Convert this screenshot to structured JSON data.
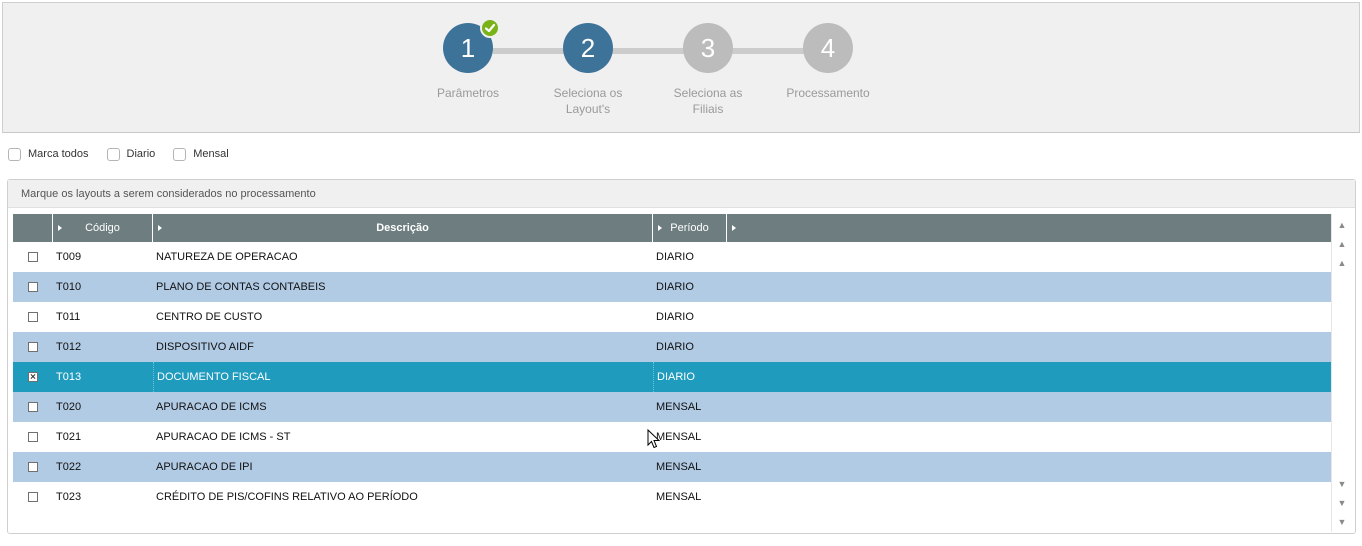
{
  "wizard": {
    "steps": [
      {
        "number": "1",
        "label": "Parâmetros",
        "state": "completed"
      },
      {
        "number": "2",
        "label": "Seleciona os Layout's",
        "state": "active"
      },
      {
        "number": "3",
        "label": "Seleciona as Filiais",
        "state": "pending"
      },
      {
        "number": "4",
        "label": "Processamento",
        "state": "pending"
      }
    ],
    "completed_icon": "check-icon"
  },
  "options": {
    "marca_todos": "Marca todos",
    "diario": "Diario",
    "mensal": "Mensal"
  },
  "panel": {
    "title": "Marque os layouts a serem considerados no processamento"
  },
  "grid": {
    "columns": {
      "code": "Código",
      "description": "Descrição",
      "period": "Período"
    },
    "rows": [
      {
        "code": "T009",
        "description": "NATUREZA DE OPERACAO",
        "period": "DIARIO",
        "checked": false
      },
      {
        "code": "T010",
        "description": "PLANO DE CONTAS CONTABEIS",
        "period": "DIARIO",
        "checked": false
      },
      {
        "code": "T011",
        "description": "CENTRO DE CUSTO",
        "period": "DIARIO",
        "checked": false
      },
      {
        "code": "T012",
        "description": "DISPOSITIVO AIDF",
        "period": "DIARIO",
        "checked": false
      },
      {
        "code": "T013",
        "description": "DOCUMENTO FISCAL",
        "period": "DIARIO",
        "checked": true
      },
      {
        "code": "T020",
        "description": "APURACAO DE ICMS",
        "period": "MENSAL",
        "checked": false
      },
      {
        "code": "T021",
        "description": "APURACAO DE ICMS - ST",
        "period": "MENSAL",
        "checked": false
      },
      {
        "code": "T022",
        "description": "APURACAO DE IPI",
        "period": "MENSAL",
        "checked": false
      },
      {
        "code": "T023",
        "description": "CRÉDITO DE PIS/COFINS RELATIVO AO PERÍODO",
        "period": "MENSAL",
        "checked": false
      }
    ]
  },
  "colors": {
    "active_step": "#3e7399",
    "pending_step": "#bcbcbc",
    "check_badge": "#7ab317",
    "header_bg": "#6e7d80",
    "row_alt": "#b2cbe5",
    "row_selected": "#1f9bbd"
  }
}
